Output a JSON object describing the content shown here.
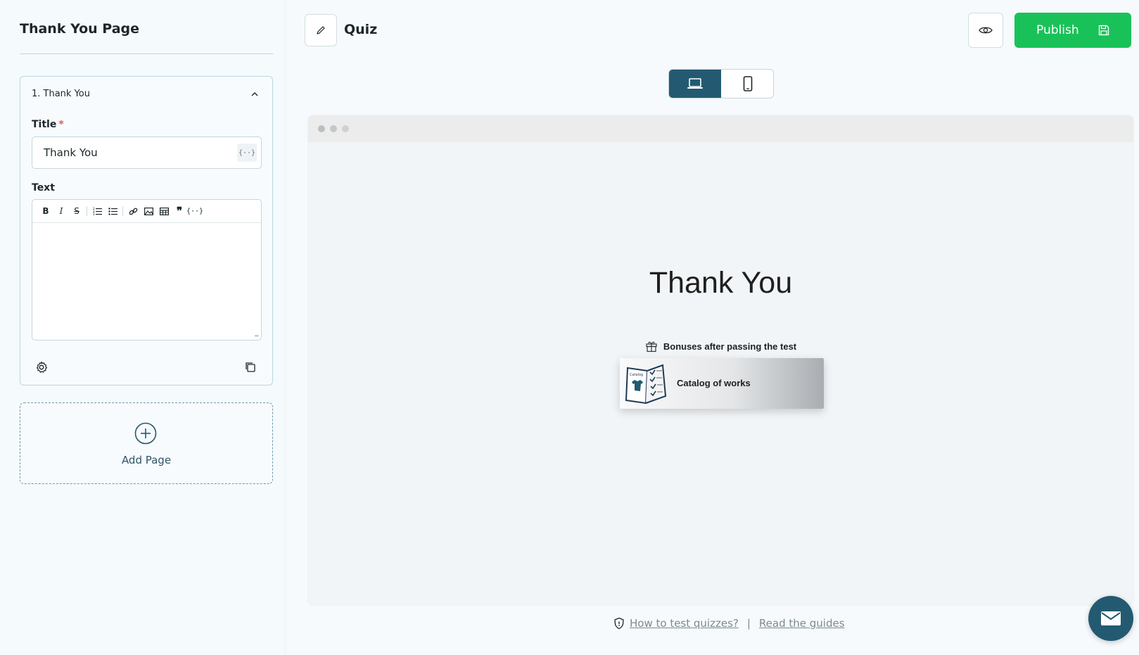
{
  "sidebar": {
    "title": "Thank You Page",
    "card": {
      "header": "1. Thank You",
      "title_label": "Title",
      "required_mark": "*",
      "title_value": "Thank You",
      "variable_glyph": "{··}",
      "text_label": "Text",
      "toolbar": [
        "bold-icon",
        "italic-icon",
        "strikethrough-icon",
        "ordered-list-icon",
        "bullet-list-icon",
        "link-icon",
        "image-icon",
        "table-icon",
        "quote-icon",
        "variable-icon"
      ],
      "toolbar_glyphs": {
        "bold": "B",
        "italic": "I",
        "strike": "S",
        "variable": "{··}",
        "quote": "❞"
      },
      "resize": "..."
    },
    "add_page_label": "Add Page"
  },
  "header": {
    "quiz_title": "Quiz",
    "publish_label": "Publish"
  },
  "preview": {
    "title": "Thank You",
    "bonus_label": "Bonuses after passing the test",
    "catalog_label": "Catalog of works",
    "catalog_image_text": "Catalog"
  },
  "footer": {
    "how_to_test": "How to test quizzes?",
    "separator": "|",
    "read_guides": "Read the guides"
  },
  "colors": {
    "accent": "#235a72",
    "publish": "#19c259",
    "required": "#e45858"
  }
}
